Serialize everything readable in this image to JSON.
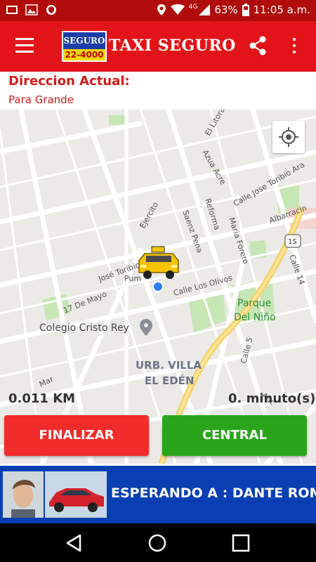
{
  "status_bar": {
    "network_type": "4G",
    "battery": "63%",
    "time": "11:05 a.m."
  },
  "toolbar": {
    "title": "TAXI SEGURO",
    "logo_top": "SEGURO",
    "logo_number": "22-4000",
    "brand_color": "#e2141a"
  },
  "address": {
    "label": "Direccion Actual:",
    "value": "Para Grande"
  },
  "map": {
    "labels": [
      "El Litoral",
      "Azua Acre",
      "Calle Jose Toribio Ara",
      "Albarracin",
      "Ejercito",
      "Saenz Pena",
      "Reforma",
      "Maria Forero",
      "1S",
      "Calle 14",
      "José Toribio Ara",
      "17 De Mayo",
      "Pum",
      "Calle Los Olivos",
      "Parque",
      "Del Niño",
      "Colegio Cristo Rey",
      "Calle 5",
      "URB. VILLA",
      "EL EDÉN",
      "Mar",
      "Auc"
    ]
  },
  "trip": {
    "distance": "0.011 KM",
    "duration": "0. minuto(s)"
  },
  "buttons": {
    "finish": "FINALIZAR",
    "central": "CENTRAL"
  },
  "banner": {
    "text": "ESPERANDO A : DANTE ROMA"
  },
  "icons": {
    "menu": "hamburger-icon",
    "share": "share-icon",
    "more": "more-vert-icon",
    "location": "my-location-icon",
    "back": "back-icon",
    "home": "home-icon",
    "recents": "recents-icon"
  }
}
